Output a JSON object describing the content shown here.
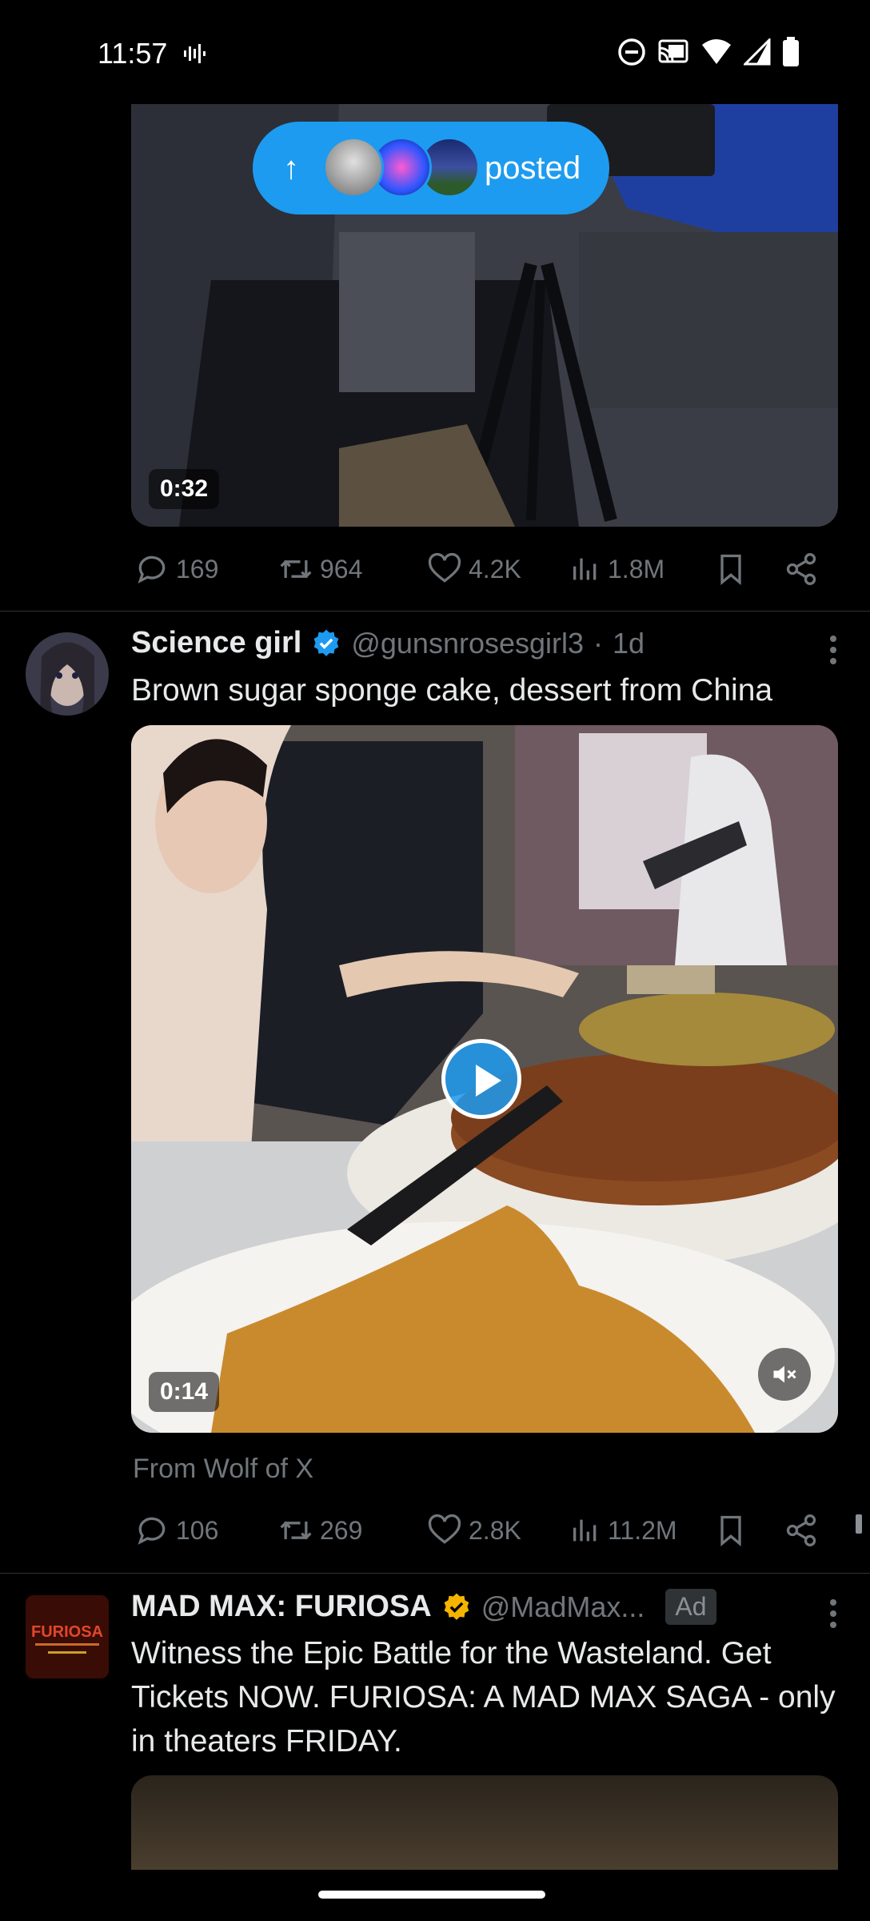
{
  "status_bar": {
    "time": "11:57",
    "icons": [
      "sound-wave-icon",
      "do-not-disturb-icon",
      "cast-icon",
      "wifi-icon",
      "signal-icon",
      "battery-icon"
    ]
  },
  "posted_pill": {
    "label": "posted",
    "arrow": "↑"
  },
  "tweet1": {
    "duration": "0:32",
    "stats": {
      "replies": "169",
      "retweets": "964",
      "likes": "4.2K",
      "views": "1.8M"
    }
  },
  "tweet2": {
    "name": "Science girl",
    "handle": "@gunsnrosesgirl3",
    "sep": "·",
    "time": "1d",
    "text": "Brown sugar sponge cake, dessert from China",
    "duration": "0:14",
    "source": "From Wolf of X",
    "stats": {
      "replies": "106",
      "retweets": "269",
      "likes": "2.8K",
      "views": "11.2M"
    }
  },
  "tweet3": {
    "name": "MAD MAX: FURIOSA",
    "handle": "@MadMax...",
    "ad_label": "Ad",
    "text": "Witness the Epic Battle for the Wasteland. Get Tickets NOW. FURIOSA: A MAD MAX SAGA - only in theaters FRIDAY.",
    "avatar_logo": "FURIOSA"
  },
  "colors": {
    "accent": "#1d9bf0",
    "background": "#000000",
    "muted": "#71767b",
    "gold": "#f4b400"
  }
}
